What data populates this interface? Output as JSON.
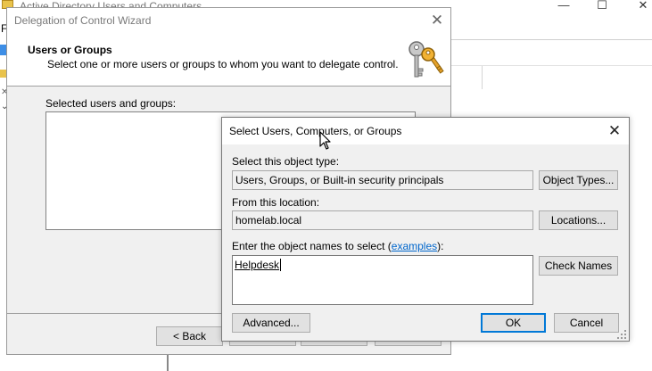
{
  "background_window": {
    "title": "Active Directory Users and Computers",
    "menu_letter": "F",
    "controls": {
      "minimize": "—",
      "maximize": "☐",
      "close": "✕"
    }
  },
  "wizard": {
    "title": "Delegation of Control Wizard",
    "close_glyph": "✕",
    "header_title": "Users or Groups",
    "header_subtitle": "Select one or more users or groups to whom you want to delegate control.",
    "list_label": "Selected users and groups:",
    "buttons": {
      "back": "< Back",
      "next": "",
      "cancel": "",
      "help": ""
    }
  },
  "select_dialog": {
    "title": "Select Users, Computers, or Groups",
    "close_glyph": "✕",
    "object_type_label": "Select this object type:",
    "object_type_value": "Users, Groups, or Built-in security principals",
    "object_types_button": "Object Types...",
    "location_label": "From this location:",
    "location_value": "homelab.local",
    "locations_button": "Locations...",
    "names_label_prefix": "Enter the object names to select (",
    "names_label_link": "examples",
    "names_label_suffix": "):",
    "names_value": "Helpdesk",
    "check_names_button": "Check Names",
    "advanced_button": "Advanced...",
    "ok_button": "OK",
    "cancel_button": "Cancel"
  },
  "colors": {
    "accent": "#0078d7",
    "link": "#0066cc",
    "dialog_bg": "#f0f0f0"
  }
}
